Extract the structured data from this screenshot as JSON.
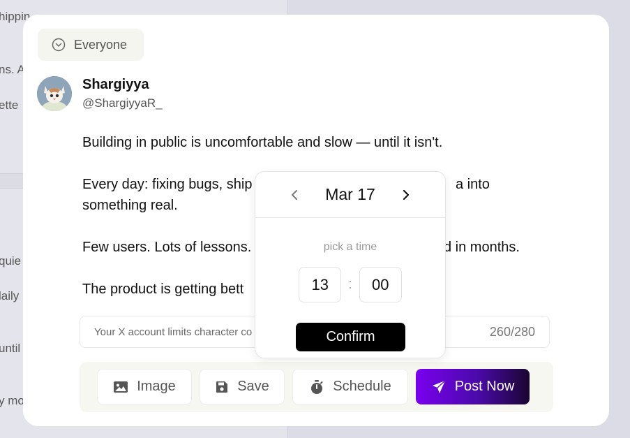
{
  "background": {
    "fragments": [
      "hippin",
      "ns. A",
      "ette",
      "quie",
      "laily",
      "until",
      "y mo"
    ]
  },
  "audience": {
    "label": "Everyone",
    "icon": "chevron-down-circle-icon"
  },
  "author": {
    "name": "Shargiyya",
    "handle": "@ShargiyyaR_"
  },
  "post": {
    "paragraphs": [
      "Building in public is uncomfortable and slow — until it isn't.",
      "Every day: fixing bugs, ship                                              a into\nsomething real.",
      "Few users. Lots of lessons.                                               d in months.",
      "The product is getting bett"
    ],
    "line1": "Building in public is uncomfortable and slow — until it isn't.",
    "line2a": "Every day: fixing bugs, ship",
    "line2b": "a into",
    "line2c": "something real.",
    "line3a": "Few users. Lots of lessons.",
    "line3b": "d in months.",
    "line4": "The product is getting bett"
  },
  "limit": {
    "text": "Your X account limits character co",
    "counter": "260/280"
  },
  "toolbar": {
    "image_label": "Image",
    "save_label": "Save",
    "schedule_label": "Schedule",
    "post_label": "Post Now"
  },
  "picker": {
    "date": "Mar 17",
    "label": "pick a time",
    "hour": "13",
    "minute": "00",
    "separator": ":",
    "confirm_label": "Confirm"
  },
  "colors": {
    "accent_start": "#7a00f0",
    "accent_end": "#1a0530",
    "confirm_bg": "#000000"
  }
}
